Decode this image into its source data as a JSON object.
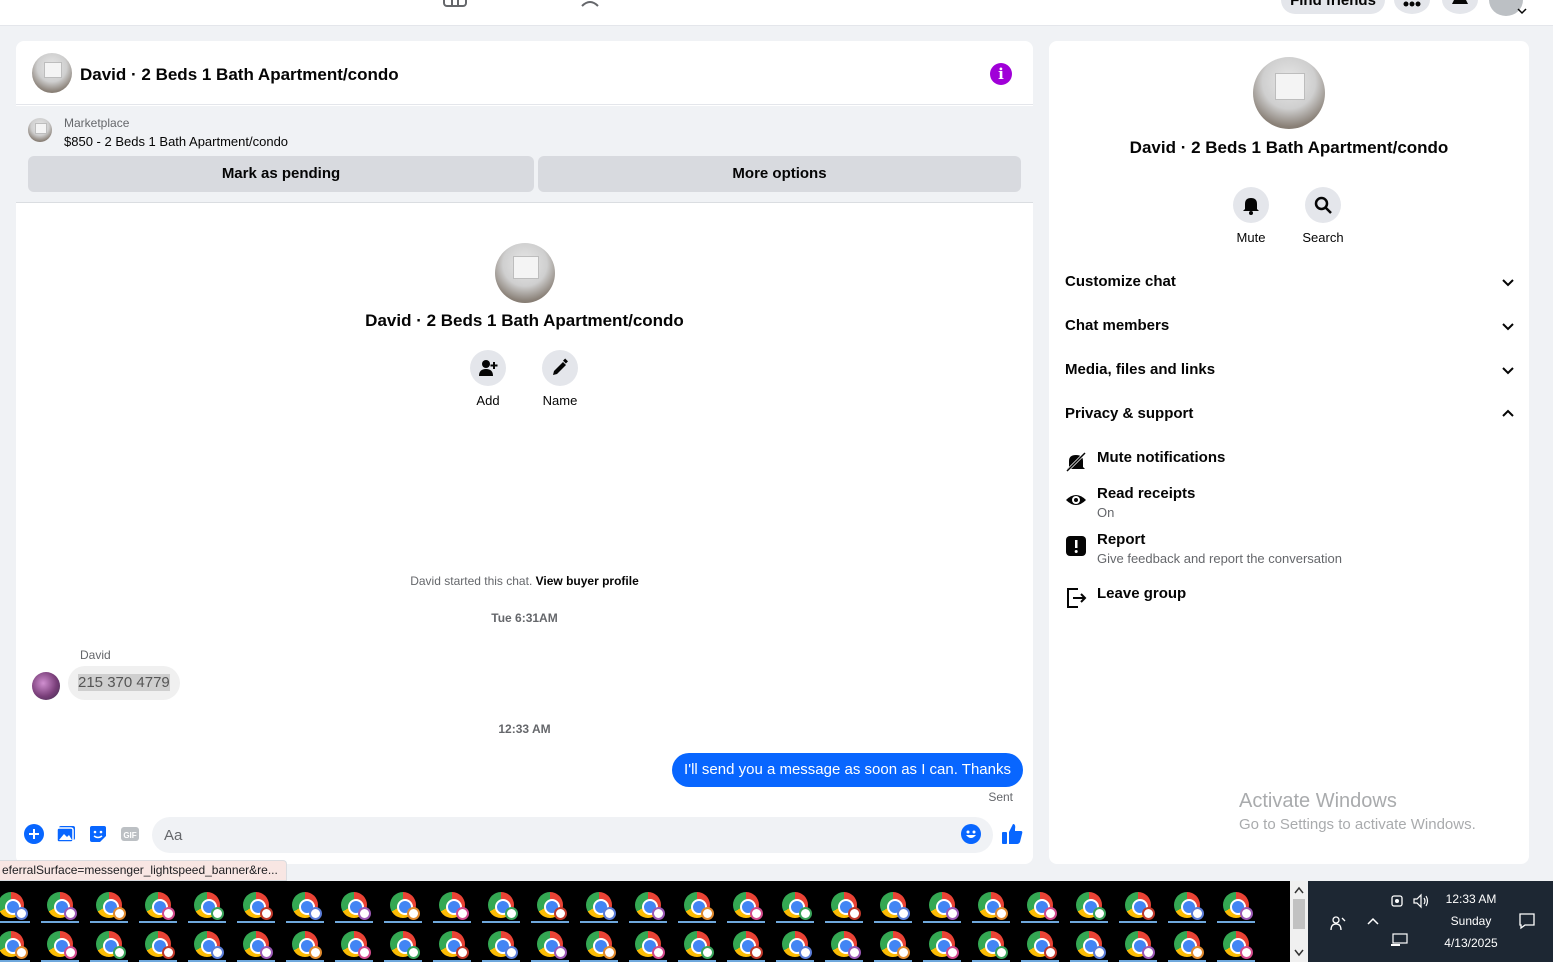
{
  "topbar": {
    "find_friends_label": "Find friends"
  },
  "chat": {
    "title": "David · 2 Beds 1 Bath Apartment/condo",
    "marketplace_label": "Marketplace",
    "listing": "$850 - 2 Beds 1 Bath Apartment/condo",
    "mark_pending_label": "Mark as pending",
    "more_options_label": "More options",
    "add_label": "Add",
    "name_label": "Name",
    "started_text": "David started this chat.",
    "view_profile_label": "View buyer profile",
    "time_1": "Tue 6:31AM",
    "sender": "David",
    "incoming_message": "215 370 4779",
    "time_2": "12:33 AM",
    "outgoing_message": "I'll send you a message as soon as I can. Thanks",
    "sent_status": "Sent",
    "input_placeholder": "Aa"
  },
  "url_hint": "eferralSurface=messenger_lightspeed_banner&re...",
  "details": {
    "title": "David · 2 Beds 1 Bath Apartment/condo",
    "mute_label": "Mute",
    "search_label": "Search",
    "sections": [
      "Customize chat",
      "Chat members",
      "Media, files and links",
      "Privacy & support"
    ],
    "options": [
      {
        "title": "Mute notifications",
        "sub": ""
      },
      {
        "title": "Read receipts",
        "sub": "On"
      },
      {
        "title": "Report",
        "sub": "Give feedback and report the conversation"
      },
      {
        "title": "Leave group",
        "sub": ""
      }
    ]
  },
  "watermark": {
    "line1": "Activate Windows",
    "line2": "Go to Settings to activate Windows."
  },
  "tray": {
    "time": "12:33 AM",
    "day": "Sunday",
    "date": "4/13/2025"
  },
  "colors": {
    "accent": "#0866ff",
    "info": "#a000d8",
    "taskbar": "#000000"
  }
}
